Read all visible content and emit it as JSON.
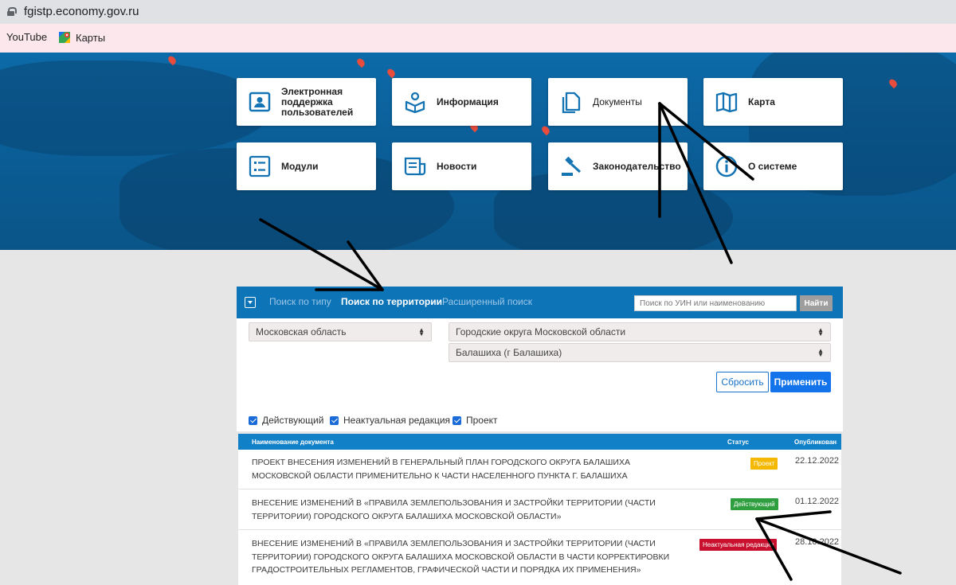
{
  "browser": {
    "url": "fgistp.economy.gov.ru",
    "bookmarks": [
      "YouTube",
      "Карты"
    ]
  },
  "tiles": [
    {
      "label": "Электронная поддержка пользователей",
      "icon": "user-card-icon"
    },
    {
      "label": "Информация",
      "icon": "info-reader-icon"
    },
    {
      "label": "Документы",
      "icon": "documents-icon"
    },
    {
      "label": "Карта",
      "icon": "map-icon"
    },
    {
      "label": "Модули",
      "icon": "modules-list-icon"
    },
    {
      "label": "Новости",
      "icon": "newspaper-icon"
    },
    {
      "label": "Законодательство",
      "icon": "gavel-icon"
    },
    {
      "label": "О системе",
      "icon": "info-circle-icon"
    }
  ],
  "search": {
    "tabs": [
      "Поиск по типу",
      "Поиск по территории",
      "Расширенный поиск"
    ],
    "active_tab": "Поиск по территории",
    "placeholder": "Поиск по УИН или наименованию",
    "find_label": "Найти",
    "region": "Московская область",
    "district": "Городские округа Московской области",
    "municipality": "Балашиха (г Балашиха)",
    "reset_label": "Сбросить",
    "apply_label": "Применить",
    "filters": [
      {
        "label": "Действующий",
        "checked": true
      },
      {
        "label": "Неактуальная редакция",
        "checked": true
      },
      {
        "label": "Проект",
        "checked": true
      }
    ]
  },
  "table": {
    "headers": [
      "Наименование документа",
      "Статус",
      "Опубликован"
    ],
    "rows": [
      {
        "name": "ПРОЕКТ ВНЕСЕНИЯ ИЗМЕНЕНИЙ В ГЕНЕРАЛЬНЫЙ ПЛАН ГОРОДСКОГО ОКРУГА БАЛАШИХА МОСКОВСКОЙ ОБЛАСТИ ПРИМЕНИТЕЛЬНО К ЧАСТИ НАСЕЛЕННОГО ПУНКТА Г. БАЛАШИХА",
        "status": "Проект",
        "status_color": "#f5b800",
        "date": "22.12.2022"
      },
      {
        "name": "ВНЕСЕНИЕ ИЗМЕНЕНИЙ В «ПРАВИЛА ЗЕМЛЕПОЛЬЗОВАНИЯ И ЗАСТРОЙКИ ТЕРРИТОРИИ (ЧАСТИ ТЕРРИТОРИИ) ГОРОДСКОГО ОКРУГА БАЛАШИХА МОСКОВСКОЙ ОБЛАСТИ»",
        "status": "Действующий",
        "status_color": "#2e9e3e",
        "date": "01.12.2022"
      },
      {
        "name": "ВНЕСЕНИЕ ИЗМЕНЕНИЙ В «ПРАВИЛА ЗЕМЛЕПОЛЬЗОВАНИЯ И ЗАСТРОЙКИ ТЕРРИТОРИИ (ЧАСТИ ТЕРРИТОРИИ) ГОРОДСКОГО ОКРУГА БАЛАШИХА МОСКОВСКОЙ ОБЛАСТИ В ЧАСТИ КОРРЕКТИРОВКИ ГРАДОСТРОИТЕЛЬНЫХ РЕГЛАМЕНТОВ, ГРАФИЧЕСКОЙ ЧАСТИ И ПОРЯДКА ИХ ПРИМЕНЕНИЯ»",
        "status": "Неактуальная редакция",
        "status_color": "#c8102e",
        "date": "28.10.2022"
      }
    ]
  },
  "colors": {
    "header_blue": "#0e74b8",
    "apply_blue": "#1273eb"
  }
}
